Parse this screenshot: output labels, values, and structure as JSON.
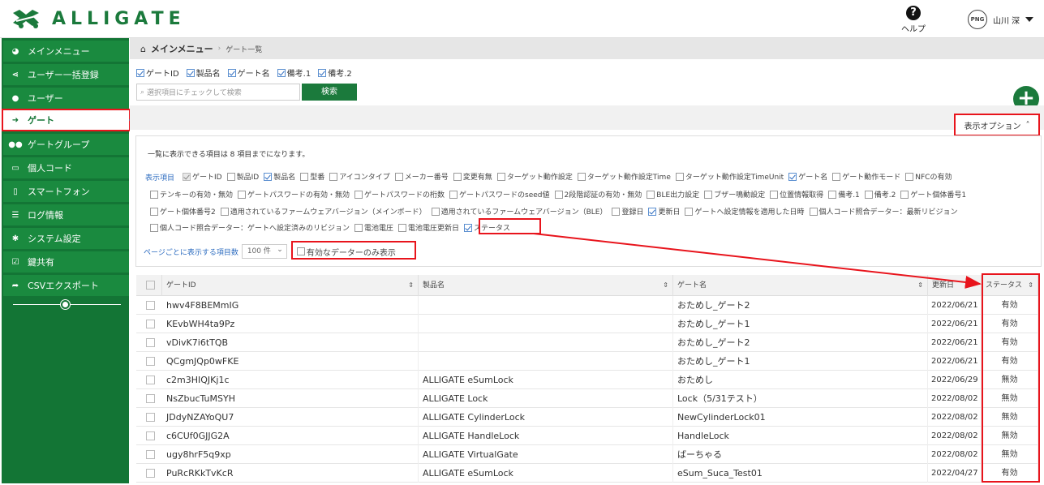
{
  "header": {
    "logo_text": "ALLIGATE",
    "help_label": "ヘルプ",
    "avatar_text": "PNG",
    "user_name": "山川 深"
  },
  "sidebar": {
    "items": [
      {
        "label": "メインメニュー",
        "icon": "dashboard-icon",
        "active": false
      },
      {
        "label": "ユーザー一括登録",
        "icon": "share-icon",
        "active": false
      },
      {
        "label": "ユーザー",
        "icon": "user-icon",
        "active": false
      },
      {
        "label": "ゲート",
        "icon": "sign-in-icon",
        "active": true
      },
      {
        "label": "ゲートグループ",
        "icon": "users-icon",
        "active": false
      },
      {
        "label": "個人コード",
        "icon": "card-icon",
        "active": false
      },
      {
        "label": "スマートフォン",
        "icon": "smartphone-icon",
        "active": false
      },
      {
        "label": "ログ情報",
        "icon": "list-icon",
        "active": false
      },
      {
        "label": "システム設定",
        "icon": "gear-icon",
        "active": false
      },
      {
        "label": "鍵共有",
        "icon": "check-square-icon",
        "active": false
      },
      {
        "label": "CSVエクスポート",
        "icon": "share-arrow-icon",
        "active": false
      }
    ]
  },
  "breadcrumb": {
    "main": "メインメニュー",
    "sub": "ゲート一覧"
  },
  "search": {
    "checkboxes": [
      {
        "label": "ゲートID",
        "checked": true
      },
      {
        "label": "製品名",
        "checked": true
      },
      {
        "label": "ゲート名",
        "checked": true
      },
      {
        "label": "備考.1",
        "checked": true
      },
      {
        "label": "備考.2",
        "checked": true
      }
    ],
    "placeholder": "選択項目にチェックして検索",
    "button_label": "検索"
  },
  "options": {
    "toggle_label": "表示オプション",
    "note": "一覧に表示できる項目は 8 項目までになります。",
    "display_label": "表示項目",
    "rows": [
      [
        {
          "label": "ゲートID",
          "checked": true,
          "disabled": true
        },
        {
          "label": "製品ID",
          "checked": false
        },
        {
          "label": "製品名",
          "checked": true
        },
        {
          "label": "型番",
          "checked": false
        },
        {
          "label": "アイコンタイプ",
          "checked": false
        },
        {
          "label": "メーカー番号",
          "checked": false
        },
        {
          "label": "変更有無",
          "checked": false
        },
        {
          "label": "ターゲット動作設定",
          "checked": false
        },
        {
          "label": "ターゲット動作設定Time",
          "checked": false
        },
        {
          "label": "ターゲット動作設定TimeUnit",
          "checked": false
        },
        {
          "label": "ゲート名",
          "checked": true
        },
        {
          "label": "ゲート動作モード",
          "checked": false
        },
        {
          "label": "NFCの有効",
          "checked": false
        }
      ],
      [
        {
          "label": "テンキーの有効・無効",
          "checked": false
        },
        {
          "label": "ゲートパスワードの有効・無効",
          "checked": false
        },
        {
          "label": "ゲートパスワードの桁数",
          "checked": false
        },
        {
          "label": "ゲートパスワードのseed値",
          "checked": false
        },
        {
          "label": "2段階認証の有効・無効",
          "checked": false
        },
        {
          "label": "BLE出力設定",
          "checked": false
        },
        {
          "label": "ブザー鳴動設定",
          "checked": false
        },
        {
          "label": "位置情報取得",
          "checked": false
        },
        {
          "label": "備考.1",
          "checked": false
        },
        {
          "label": "備考.2",
          "checked": false
        },
        {
          "label": "ゲート個体番号1",
          "checked": false
        }
      ],
      [
        {
          "label": "ゲート個体番号2",
          "checked": false
        },
        {
          "label": "適用されているファームウェアバージョン（メインボード）",
          "checked": false
        },
        {
          "label": "適用されているファームウェアバージョン（BLE）",
          "checked": false
        },
        {
          "label": "登録日",
          "checked": false
        },
        {
          "label": "更新日",
          "checked": true
        },
        {
          "label": "ゲートへ設定情報を適用した日時",
          "checked": false
        },
        {
          "label": "個人コード照合データー：最新リビジョン",
          "checked": false
        }
      ],
      [
        {
          "label": "個人コード照合データー：ゲートへ設定済みのリビジョン",
          "checked": false
        },
        {
          "label": "電池電圧",
          "checked": false
        },
        {
          "label": "電池電圧更新日",
          "checked": false
        },
        {
          "label": "ステータス",
          "checked": true
        }
      ]
    ],
    "perpage_label": "ページごとに表示する項目数",
    "perpage_value": "100 件",
    "valid_only_label": "有効なデーターのみ表示"
  },
  "table": {
    "headers": {
      "gate_id": "ゲートID",
      "product": "製品名",
      "gate_name": "ゲート名",
      "updated": "更新日",
      "status": "ステータス"
    },
    "rows": [
      {
        "gate_id": "hwv4F8BEMmIG",
        "product": "",
        "gate_name": "おためし_ゲート2",
        "updated": "2022/06/21",
        "status": "有効"
      },
      {
        "gate_id": "KEvbWH4ta9Pz",
        "product": "",
        "gate_name": "おためし_ゲート1",
        "updated": "2022/06/21",
        "status": "有効"
      },
      {
        "gate_id": "vDivK7i6tTQB",
        "product": "",
        "gate_name": "おためし_ゲート2",
        "updated": "2022/06/21",
        "status": "有効"
      },
      {
        "gate_id": "QCgmJQp0wFKE",
        "product": "",
        "gate_name": "おためし_ゲート1",
        "updated": "2022/06/21",
        "status": "有効"
      },
      {
        "gate_id": "c2m3HIQJKj1c",
        "product": "ALLIGATE eSumLock",
        "gate_name": "おためし",
        "updated": "2022/06/29",
        "status": "無効"
      },
      {
        "gate_id": "NsZbucTuMSYH",
        "product": "ALLIGATE Lock",
        "gate_name": "Lock（5/31テスト）",
        "updated": "2022/08/02",
        "status": "無効"
      },
      {
        "gate_id": "JDdyNZAYoQU7",
        "product": "ALLIGATE CylinderLock",
        "gate_name": "NewCylinderLock01",
        "updated": "2022/08/02",
        "status": "無効"
      },
      {
        "gate_id": "c6CUf0GJJG2A",
        "product": "ALLIGATE HandleLock",
        "gate_name": "HandleLock",
        "updated": "2022/08/02",
        "status": "無効"
      },
      {
        "gate_id": "ugy8hrF5q9xp",
        "product": "ALLIGATE VirtualGate",
        "gate_name": "ばーちゃる",
        "updated": "2022/08/02",
        "status": "無効"
      },
      {
        "gate_id": "PuRcRKkTvKcR",
        "product": "ALLIGATE eSumLock",
        "gate_name": "eSum_Suca_Test01",
        "updated": "2022/04/27",
        "status": "有効"
      }
    ]
  },
  "colors": {
    "brand": "#1b7a3c",
    "sidebar": "#137535",
    "highlight": "#e8141c",
    "link": "#2d6cc0"
  }
}
